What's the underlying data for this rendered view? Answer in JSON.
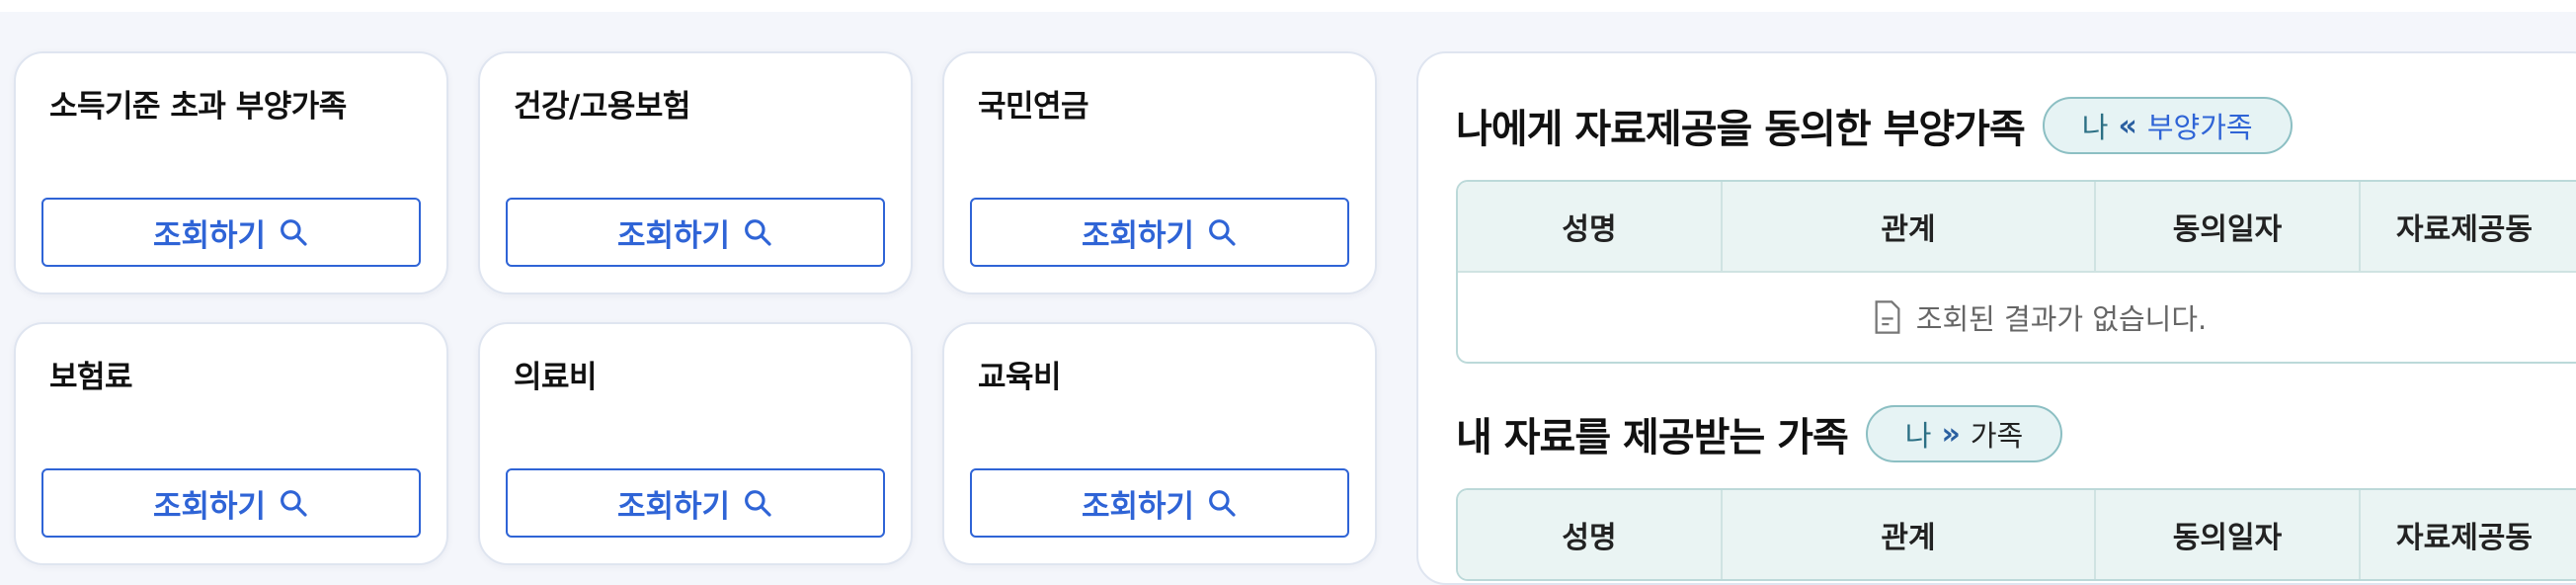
{
  "cards": [
    {
      "title": "소득기준 초과 부양가족",
      "button": "조회하기"
    },
    {
      "title": "건강/고용보험",
      "button": "조회하기"
    },
    {
      "title": "국민연금",
      "button": "조회하기"
    },
    {
      "title": "보험료",
      "button": "조회하기"
    },
    {
      "title": "의료비",
      "button": "조회하기"
    },
    {
      "title": "교육비",
      "button": "조회하기"
    }
  ],
  "consented": {
    "title": "나에게 자료제공을 동의한 부양가족",
    "pill": {
      "me": "나",
      "arrows": "«",
      "who": "부양가족"
    },
    "headers": [
      "성명",
      "관계",
      "동의일자",
      "자료제공동"
    ],
    "empty_text": "조회된 결과가 없습니다."
  },
  "providing": {
    "title": "내 자료를 제공받는 가족",
    "pill": {
      "me": "나",
      "arrows": "»",
      "who": "가족"
    },
    "headers": [
      "성명",
      "관계",
      "동의일자",
      "자료제공동"
    ]
  },
  "icons": {
    "search": "search-icon",
    "document": "document-icon"
  },
  "colors": {
    "accent": "#2f64d6",
    "teal": "#8cbfc3"
  }
}
